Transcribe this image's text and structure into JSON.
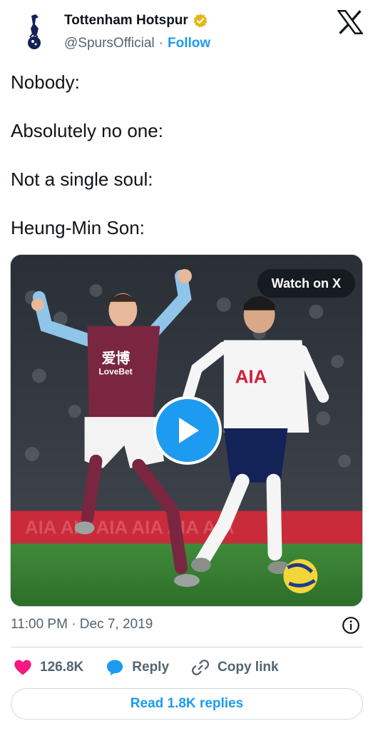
{
  "header": {
    "display_name": "Tottenham Hotspur",
    "handle": "@SpursOfficial",
    "separator": "·",
    "follow_label": "Follow",
    "verified_badge": "gold-verified-icon",
    "close_icon": "x-logo-icon"
  },
  "tweet": {
    "lines": [
      "Nobody:",
      "Absolutely no one:",
      "Not a single soul:",
      "Heung-Min Son:"
    ]
  },
  "media": {
    "watch_label": "Watch on X",
    "play_icon": "play-icon",
    "shirt_sponsor_left": "LoveBet",
    "shirt_sponsor_left_chinese": "爱博",
    "shirt_sponsor_right": "AIA"
  },
  "meta": {
    "timestamp": "11:00 PM · Dec 7, 2019",
    "info_icon": "info-icon"
  },
  "actions": {
    "like_count": "126.8K",
    "reply_label": "Reply",
    "copy_link_label": "Copy link"
  },
  "footer": {
    "read_replies_label": "Read 1.8K replies"
  },
  "colors": {
    "accent": "#1d9bf0",
    "like": "#f91880",
    "text": "#0f1419",
    "muted": "#536471",
    "border": "#cfd9de"
  }
}
